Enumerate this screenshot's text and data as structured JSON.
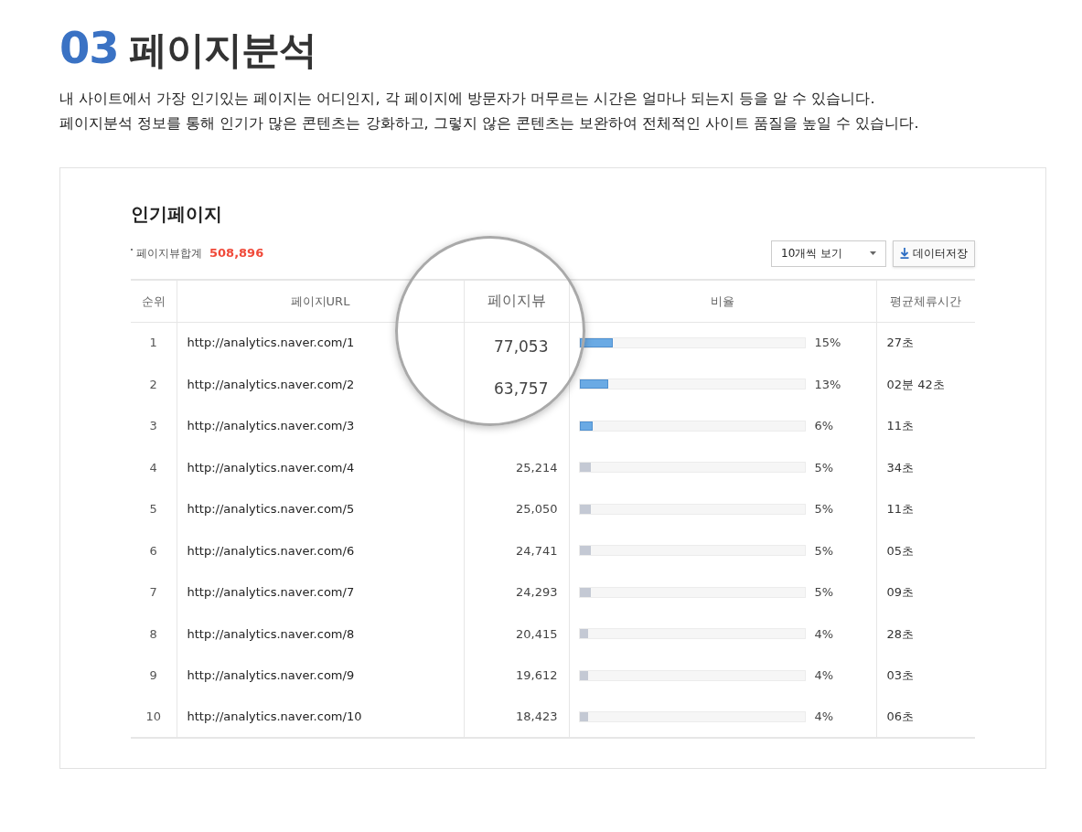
{
  "heading": {
    "number": "03",
    "title": "페이지분석"
  },
  "description": [
    "내 사이트에서 가장 인기있는 페이지는 어디인지, 각 페이지에 방문자가 머무르는 시간은 얼마나 되는지 등을 알 수 있습니다.",
    "페이지분석 정보를 통해 인기가 많은 콘텐츠는 강화하고, 그렇지 않은 콘텐츠는 보완하여 전체적인 사이트 품질을 높일 수 있습니다."
  ],
  "panel": {
    "title": "인기페이지",
    "total_label": "페이지뷰합계",
    "total_value": "508,896",
    "page_size_select": "10개씩 보기",
    "save_button": "데이터저장",
    "columns": [
      "순위",
      "페이지URL",
      "페이지뷰",
      "비율",
      "평균체류시간"
    ],
    "rows": [
      {
        "rank": "1",
        "url": "http://analytics.naver.com/1",
        "views": "77,053",
        "magnified": true,
        "highlighted": true,
        "level": 0.15,
        "ratio": "15%",
        "time": "27초"
      },
      {
        "rank": "2",
        "url": "http://analytics.naver.com/2",
        "views": "63,757",
        "magnified": true,
        "highlighted": true,
        "level": 0.13,
        "ratio": "13%",
        "time": "02분 42초"
      },
      {
        "rank": "3",
        "url": "http://analytics.naver.com/3",
        "magnified": false,
        "highlighted": true,
        "level": 0.06,
        "ratio": "6%",
        "time": "11초"
      },
      {
        "rank": "4",
        "url": "http://analytics.naver.com/4",
        "views": "25,214",
        "magnified": false,
        "highlighted": false,
        "level": 0.05,
        "ratio": "5%",
        "time": "34초"
      },
      {
        "rank": "5",
        "url": "http://analytics.naver.com/5",
        "views": "25,050",
        "magnified": false,
        "highlighted": false,
        "level": 0.05,
        "ratio": "5%",
        "time": "11초"
      },
      {
        "rank": "6",
        "url": "http://analytics.naver.com/6",
        "views": "24,741",
        "magnified": false,
        "highlighted": false,
        "level": 0.05,
        "ratio": "5%",
        "time": "05초"
      },
      {
        "rank": "7",
        "url": "http://analytics.naver.com/7",
        "views": "24,293",
        "magnified": false,
        "highlighted": false,
        "level": 0.05,
        "ratio": "5%",
        "time": "09초"
      },
      {
        "rank": "8",
        "url": "http://analytics.naver.com/8",
        "views": "20,415",
        "magnified": false,
        "highlighted": false,
        "level": 0.04,
        "ratio": "4%",
        "time": "28초"
      },
      {
        "rank": "9",
        "url": "http://analytics.naver.com/9",
        "views": "19,612",
        "magnified": false,
        "highlighted": false,
        "level": 0.04,
        "ratio": "4%",
        "time": "03초"
      },
      {
        "rank": "10",
        "url": "http://analytics.naver.com/10",
        "views": "18,423",
        "magnified": false,
        "highlighted": false,
        "level": 0.04,
        "ratio": "4%",
        "time": "06초"
      }
    ]
  }
}
